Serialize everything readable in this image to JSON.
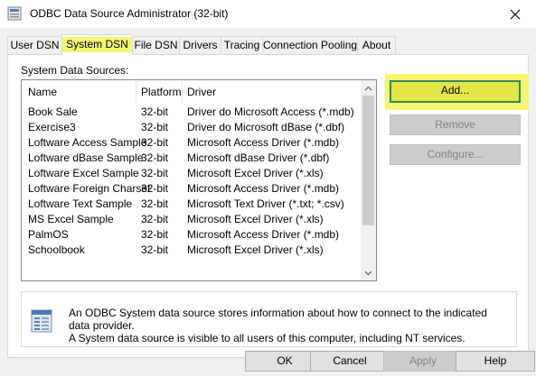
{
  "window": {
    "title": "ODBC Data Source Administrator (32-bit)",
    "close_glyph": "✕"
  },
  "tabs": [
    {
      "label": "User DSN",
      "active": false
    },
    {
      "label": "System DSN",
      "active": true
    },
    {
      "label": "File DSN",
      "active": false
    },
    {
      "label": "Drivers",
      "active": false
    },
    {
      "label": "Tracing",
      "active": false
    },
    {
      "label": "Connection Pooling",
      "active": false
    },
    {
      "label": "About",
      "active": false
    }
  ],
  "panel": {
    "group_label": "System Data Sources:",
    "columns": [
      "Name",
      "Platform",
      "Driver"
    ],
    "rows": [
      {
        "name": "Book Sale",
        "platform": "32-bit",
        "driver": "Driver do Microsoft Access (*.mdb)"
      },
      {
        "name": "Exercise3",
        "platform": "32-bit",
        "driver": "Driver do Microsoft dBase (*.dbf)"
      },
      {
        "name": "Loftware Access Sample",
        "platform": "32-bit",
        "driver": "Microsoft Access Driver (*.mdb)"
      },
      {
        "name": "Loftware dBase Sample",
        "platform": "32-bit",
        "driver": "Microsoft dBase Driver (*.dbf)"
      },
      {
        "name": "Loftware Excel Sample",
        "platform": "32-bit",
        "driver": "Microsoft Excel Driver (*.xls)"
      },
      {
        "name": "Loftware Foreign Charset",
        "platform": "32-bit",
        "driver": "Microsoft Access Driver (*.mdb)"
      },
      {
        "name": "Loftware Text Sample",
        "platform": "32-bit",
        "driver": "Microsoft Text Driver (*.txt; *.csv)"
      },
      {
        "name": "MS Excel Sample",
        "platform": "32-bit",
        "driver": "Microsoft Excel Driver (*.xls)"
      },
      {
        "name": "PalmOS",
        "platform": "32-bit",
        "driver": "Microsoft Access Driver (*.mdb)"
      },
      {
        "name": "Schoolbook",
        "platform": "32-bit",
        "driver": "Microsoft Excel Driver (*.xls)"
      }
    ],
    "buttons": {
      "add": "Add...",
      "remove": "Remove",
      "configure": "Configure..."
    },
    "info_text_line1": "An ODBC System data source stores information about how to connect to the indicated data provider.",
    "info_text_line2": "A System data source is visible to all users of this computer, including NT services."
  },
  "footer": {
    "ok": "OK",
    "cancel": "Cancel",
    "apply": "Apply",
    "help": "Help"
  },
  "colors": {
    "highlight": "#f5f571",
    "add_border": "#2e8b57"
  }
}
